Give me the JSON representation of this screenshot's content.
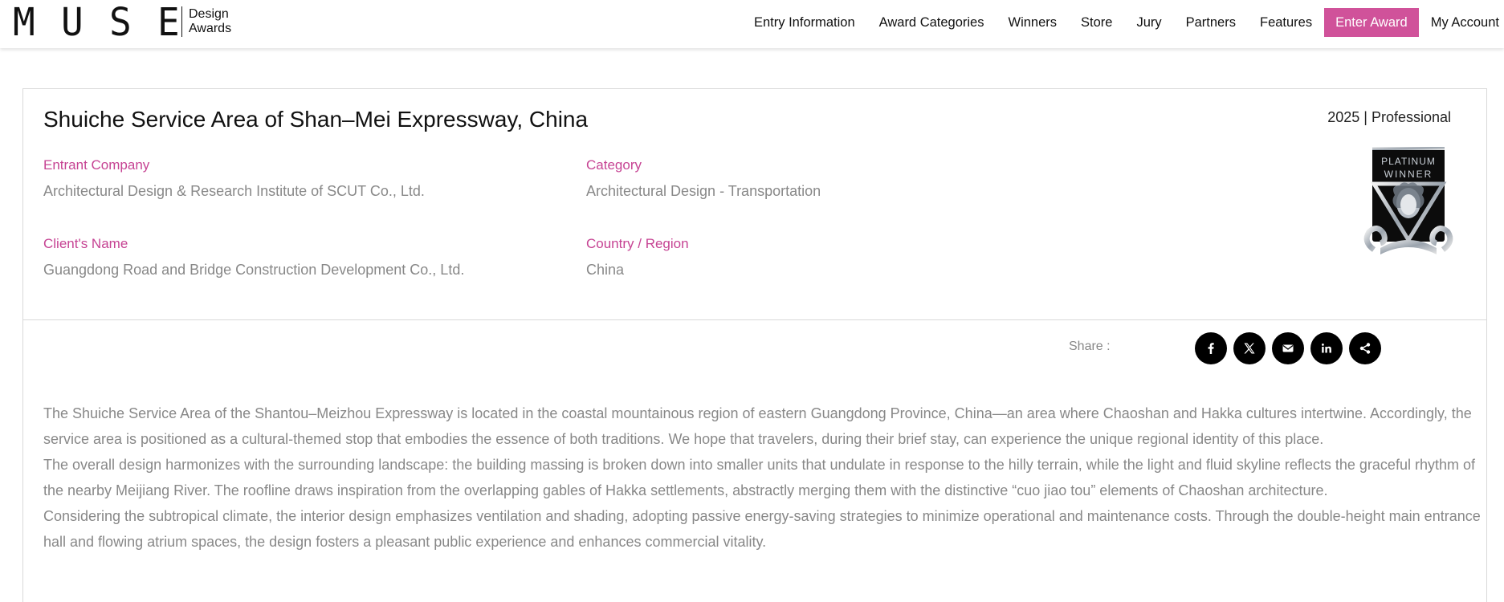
{
  "header": {
    "logo_letters": [
      "M",
      "U",
      "S",
      "E"
    ],
    "logo_sub_line1": "Design",
    "logo_sub_line2": "Awards",
    "nav": [
      {
        "label": "Entry Information"
      },
      {
        "label": "Award Categories"
      },
      {
        "label": "Winners"
      },
      {
        "label": "Store"
      },
      {
        "label": "Jury"
      },
      {
        "label": "Partners"
      },
      {
        "label": "Features"
      }
    ],
    "cta_label": "Enter Award",
    "account_label": "My Account",
    "cta_color": "#d0529a"
  },
  "entry": {
    "title": "Shuiche Service Area of Shan–Mei Expressway, China",
    "year_level": "2025 | Professional",
    "fields": {
      "entrant_company_label": "Entrant Company",
      "entrant_company": "Architectural Design & Research Institute of SCUT Co., Ltd.",
      "category_label": "Category",
      "category": "Architectural Design - Transportation",
      "client_label": "Client's Name",
      "client": "Guangdong Road and Bridge Construction Development Co., Ltd.",
      "country_label": "Country / Region",
      "country": "China"
    },
    "badge": {
      "line1": "PLATINUM",
      "line2": "WINNER"
    }
  },
  "share": {
    "label": "Share :",
    "icons": [
      "facebook-icon",
      "x-icon",
      "email-icon",
      "linkedin-icon",
      "share-icon"
    ]
  },
  "description": [
    "The Shuiche Service Area of the Shantou–Meizhou Expressway is located in the coastal mountainous region of eastern Guangdong Province, China—an area where Chaoshan and Hakka cultures intertwine. Accordingly, the service area is positioned as a cultural-themed stop that embodies the essence of both traditions. We hope that travelers, during their brief stay, can experience the unique regional identity of this place.",
    "The overall design harmonizes with the surrounding landscape: the building massing is broken down into smaller units that undulate in response to the hilly terrain, while the light and fluid skyline reflects the graceful rhythm of the nearby Meijiang River. The roofline draws inspiration from the overlapping gables of Hakka settlements, abstractly merging them with the distinctive “cuo jiao tou” elements of Chaoshan architecture.",
    "Considering the subtropical climate, the interior design emphasizes ventilation and shading, adopting passive energy-saving strategies to minimize operational and maintenance costs. Through the double-height main entrance hall and flowing atrium spaces, the design fosters a pleasant public experience and enhances commercial vitality."
  ],
  "colors": {
    "label_pink": "#c64393",
    "muted_text": "#888888"
  }
}
